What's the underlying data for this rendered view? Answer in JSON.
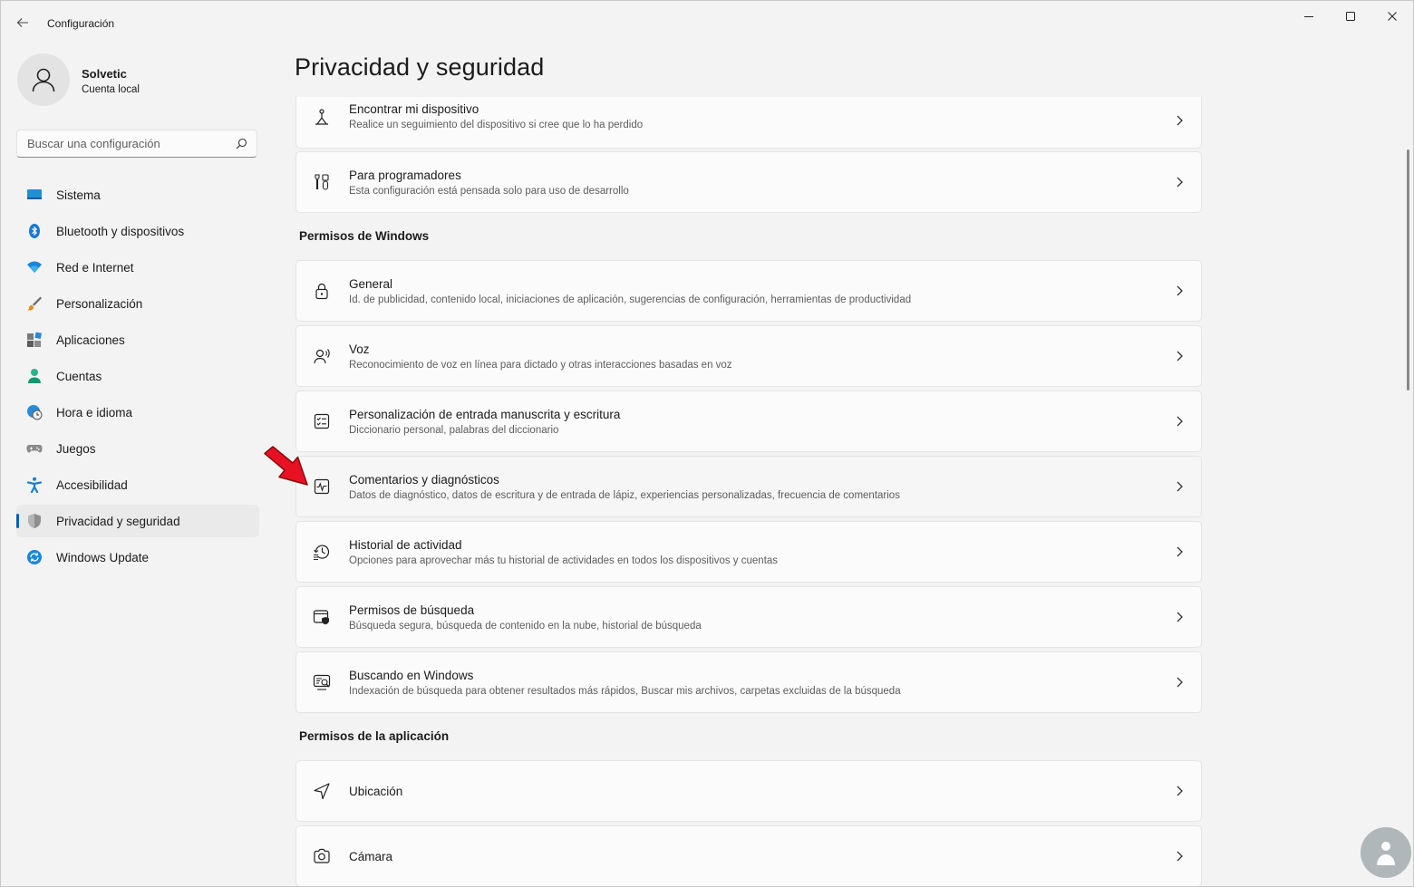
{
  "window": {
    "title": "Configuración",
    "minimize_icon": "minimize-icon",
    "maximize_icon": "maximize-icon",
    "close_icon": "close-icon"
  },
  "profile": {
    "name": "Solvetic",
    "account_type": "Cuenta local"
  },
  "search": {
    "placeholder": "Buscar una configuración",
    "value": ""
  },
  "sidebar": {
    "items": [
      {
        "label": "Sistema",
        "icon": "monitor-icon"
      },
      {
        "label": "Bluetooth y dispositivos",
        "icon": "bluetooth-icon"
      },
      {
        "label": "Red e Internet",
        "icon": "wifi-icon"
      },
      {
        "label": "Personalización",
        "icon": "brush-icon"
      },
      {
        "label": "Aplicaciones",
        "icon": "apps-icon"
      },
      {
        "label": "Cuentas",
        "icon": "person-icon"
      },
      {
        "label": "Hora e idioma",
        "icon": "globe-clock-icon"
      },
      {
        "label": "Juegos",
        "icon": "gamepad-icon"
      },
      {
        "label": "Accesibilidad",
        "icon": "accessibility-icon"
      },
      {
        "label": "Privacidad y seguridad",
        "icon": "shield-icon",
        "selected": true
      },
      {
        "label": "Windows Update",
        "icon": "update-icon"
      }
    ],
    "accent_color": "#005fb8"
  },
  "main": {
    "title": "Privacidad y seguridad",
    "top_items": [
      {
        "title": "Encontrar mi dispositivo",
        "description": "Realice un seguimiento del dispositivo si cree que lo ha perdido",
        "icon": "find-device-icon"
      },
      {
        "title": "Para programadores",
        "description": "Esta configuración está pensada solo para uso de desarrollo",
        "icon": "developer-tools-icon"
      }
    ],
    "windows_permissions": {
      "heading": "Permisos de Windows",
      "items": [
        {
          "title": "General",
          "description": "Id. de publicidad, contenido local, iniciaciones de aplicación, sugerencias de configuración, herramientas de productividad",
          "icon": "lock-icon"
        },
        {
          "title": "Voz",
          "description": "Reconocimiento de voz en línea para dictado y otras interacciones basadas en voz",
          "icon": "voice-icon"
        },
        {
          "title": "Personalización de entrada manuscrita y escritura",
          "description": "Diccionario personal, palabras del diccionario",
          "icon": "checklist-icon"
        },
        {
          "title": "Comentarios y diagnósticos",
          "description": "Datos de diagnóstico, datos de escritura y de entrada de lápiz, experiencias personalizadas, frecuencia de comentarios",
          "icon": "diagnostics-icon",
          "highlighted": true
        },
        {
          "title": "Historial de actividad",
          "description": "Opciones para aprovechar más tu historial de actividades en todos los dispositivos y cuentas",
          "icon": "history-icon"
        },
        {
          "title": "Permisos de búsqueda",
          "description": "Búsqueda segura, búsqueda de contenido en la nube, historial de búsqueda",
          "icon": "search-shield-icon"
        },
        {
          "title": "Buscando en Windows",
          "description": "Indexación de búsqueda para obtener resultados más rápidos, Buscar mis archivos, carpetas excluidas de la búsqueda",
          "icon": "search-windows-icon"
        }
      ]
    },
    "app_permissions": {
      "heading": "Permisos de la aplicación",
      "items": [
        {
          "title": "Ubicación",
          "icon": "location-icon"
        },
        {
          "title": "Cámara",
          "icon": "camera-icon"
        }
      ]
    }
  },
  "annotation": {
    "icon": "red-arrow-icon",
    "color": "#e81123"
  },
  "watermark": {
    "icon": "solvetic-logo-icon"
  }
}
